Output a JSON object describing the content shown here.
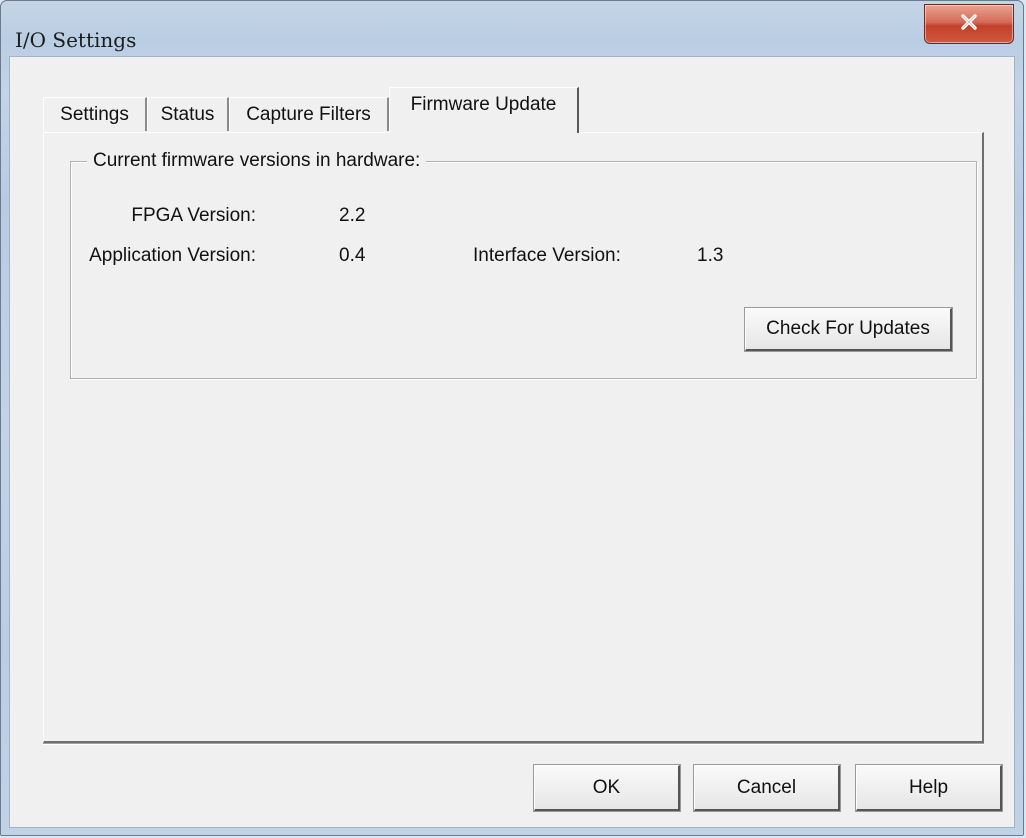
{
  "window": {
    "title": "I/O Settings",
    "close_icon": "close-icon"
  },
  "tabs": [
    {
      "label": "Settings",
      "active": false
    },
    {
      "label": "Status",
      "active": false
    },
    {
      "label": "Capture Filters",
      "active": false
    },
    {
      "label": "Firmware Update",
      "active": true
    }
  ],
  "firmware": {
    "group_title": "Current firmware versions in hardware:",
    "fpga_label": "FPGA Version:",
    "fpga_value": "2.2",
    "app_label": "Application Version:",
    "app_value": "0.4",
    "interface_label": "Interface Version:",
    "interface_value": "1.3",
    "check_button": "Check For Updates"
  },
  "footer": {
    "ok": "OK",
    "cancel": "Cancel",
    "help": "Help"
  },
  "colors": {
    "dialog_bg": "#f0f0f0",
    "frame": "#c2d3e7",
    "close_button": "#c2402a"
  }
}
